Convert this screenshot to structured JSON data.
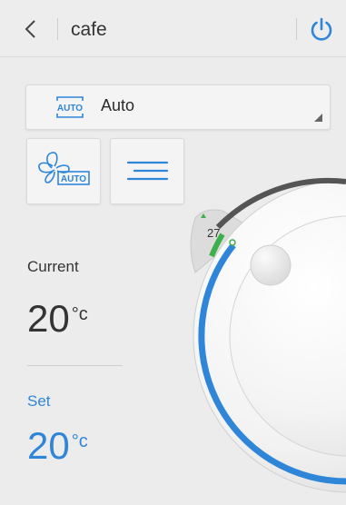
{
  "header": {
    "title": "cafe"
  },
  "mode": {
    "label": "Auto",
    "icon": "auto-mode-icon",
    "icon_text": "AUTO"
  },
  "fan": {
    "icon": "fan-auto-icon",
    "icon_text": "AUTO"
  },
  "swing": {
    "icon": "swing-lines-icon"
  },
  "current": {
    "label": "Current",
    "value": "20",
    "unit": "°c"
  },
  "set": {
    "label": "Set",
    "value": "20",
    "unit": "°c"
  },
  "dial": {
    "max_label": "27"
  },
  "colors": {
    "accent": "#2f86d8",
    "green": "#3cb04a"
  }
}
